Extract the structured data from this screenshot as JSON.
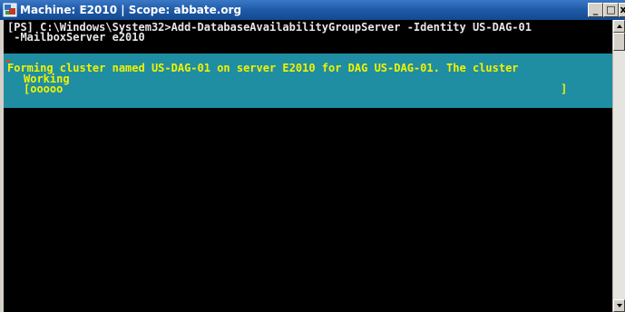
{
  "window": {
    "title": "Machine: E2010 | Scope: abbate.org",
    "min_symbol": "_",
    "max_symbol": "□",
    "close_symbol": "x"
  },
  "console": {
    "prompt_line": "[PS] C:\\Windows\\System32>Add-DatabaseAvailabilityGroupServer -Identity US-DAG-01",
    "prompt_continuation": " -MailboxServer e2010",
    "progress": {
      "activity": "Forming cluster named US-DAG-01 on server E2010 for DAG US-DAG-01. The cluster",
      "status": "Working",
      "bar_open": "[ooooo",
      "bar_close": "]"
    }
  },
  "colors": {
    "console_bg": "#000000",
    "console_text": "#e6e6e6",
    "progress_bg": "#1f8ea3",
    "progress_text": "#f2f200",
    "titlebar": "#1f5aa8"
  },
  "icons": {
    "app": "powershell-console-icon",
    "scroll_up": "arrow-up-icon",
    "scroll_down": "arrow-down-icon"
  }
}
